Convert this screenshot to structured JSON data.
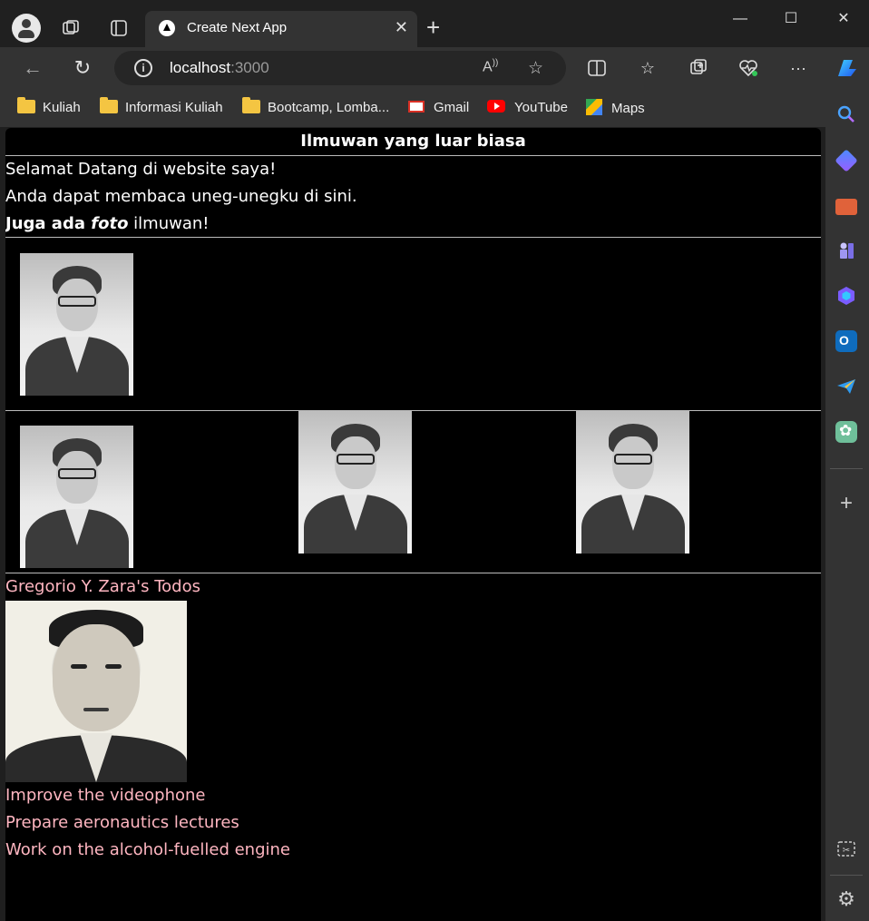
{
  "browser": {
    "tab_title": "Create Next App",
    "url_host": "localhost",
    "url_port": ":3000",
    "bookmarks": [
      "Kuliah",
      "Informasi Kuliah",
      "Bootcamp, Lomba...",
      "Gmail",
      "YouTube",
      "Maps"
    ]
  },
  "page": {
    "title": "Ilmuwan yang luar biasa",
    "intro_line1": "Selamat Datang di website saya!",
    "intro_line2": "Anda dapat membaca uneg-unegku di sini.",
    "intro_line3_bold": "Juga ada ",
    "intro_line3_bold_italic": "foto",
    "intro_line3_rest": " ilmuwan!",
    "todo_heading": "Gregorio Y. Zara's Todos",
    "todos": [
      "Improve the videophone",
      "Prepare aeronautics lectures",
      "Work on the alcohol-fuelled engine"
    ]
  },
  "colors": {
    "page_bg": "#000000",
    "accent_pink": "#ffb6c1",
    "browser_chrome": "#333333"
  }
}
